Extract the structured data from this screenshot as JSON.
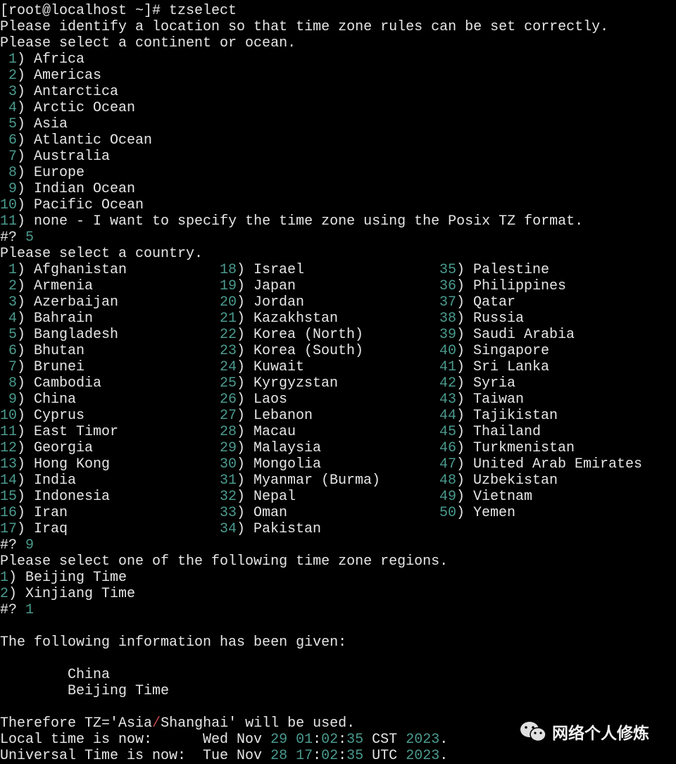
{
  "prompt": "[root@localhost ~]# tzselect",
  "intro1": "Please identify a location so that time zone rules can be set correctly.",
  "intro2": "Please select a continent or ocean.",
  "continents": [
    {
      "n": " 1",
      "label": "Africa"
    },
    {
      "n": " 2",
      "label": "Americas"
    },
    {
      "n": " 3",
      "label": "Antarctica"
    },
    {
      "n": " 4",
      "label": "Arctic Ocean"
    },
    {
      "n": " 5",
      "label": "Asia"
    },
    {
      "n": " 6",
      "label": "Atlantic Ocean"
    },
    {
      "n": " 7",
      "label": "Australia"
    },
    {
      "n": " 8",
      "label": "Europe"
    },
    {
      "n": " 9",
      "label": "Indian Ocean"
    },
    {
      "n": "10",
      "label": "Pacific Ocean"
    },
    {
      "n": "11",
      "label": "none - I want to specify the time zone using the Posix TZ format."
    }
  ],
  "answer1": "5",
  "country_prompt": "Please select a country.",
  "countries": [
    " 1|Afghanistan",
    " 2|Armenia",
    " 3|Azerbaijan",
    " 4|Bahrain",
    " 5|Bangladesh",
    " 6|Bhutan",
    " 7|Brunei",
    " 8|Cambodia",
    " 9|China",
    "10|Cyprus",
    "11|East Timor",
    "12|Georgia",
    "13|Hong Kong",
    "14|India",
    "15|Indonesia",
    "16|Iran",
    "17|Iraq",
    "18|Israel",
    "19|Japan",
    "20|Jordan",
    "21|Kazakhstan",
    "22|Korea (North)",
    "23|Korea (South)",
    "24|Kuwait",
    "25|Kyrgyzstan",
    "26|Laos",
    "27|Lebanon",
    "28|Macau",
    "29|Malaysia",
    "30|Mongolia",
    "31|Myanmar (Burma)",
    "32|Nepal",
    "33|Oman",
    "34|Pakistan",
    "35|Palestine",
    "36|Philippines",
    "37|Qatar",
    "38|Russia",
    "39|Saudi Arabia",
    "40|Singapore",
    "41|Sri Lanka",
    "42|Syria",
    "43|Taiwan",
    "44|Tajikistan",
    "45|Thailand",
    "46|Turkmenistan",
    "47|United Arab Emirates",
    "48|Uzbekistan",
    "49|Vietnam",
    "50|Yemen"
  ],
  "answer2": "9",
  "region_prompt": "Please select one of the following time zone regions.",
  "regions": [
    {
      "n": "1",
      "label": "Beijing Time"
    },
    {
      "n": "2",
      "label": "Xinjiang Time"
    }
  ],
  "answer3": "1",
  "info_heading": "The following information has been given:",
  "info_country": "        China",
  "info_region": "        Beijing Time",
  "tz_line": {
    "pre": "Therefore TZ='Asia",
    "slash": "/",
    "post": "Shanghai' will be used."
  },
  "local_time": {
    "label": "Local time is now:      ",
    "day": "Wed Nov ",
    "date": "29",
    "h": "01",
    "m": "02",
    "s": "35",
    "zone": " CST ",
    "year": "2023"
  },
  "utc_time": {
    "label": "Universal Time is now:  ",
    "day": "Tue Nov ",
    "date": "28",
    "h": "17",
    "m": "02",
    "s": "35",
    "zone": " UTC ",
    "year": "2023"
  },
  "watermark": {
    "icon": "wechat-icon",
    "text": "网络个人修炼"
  }
}
